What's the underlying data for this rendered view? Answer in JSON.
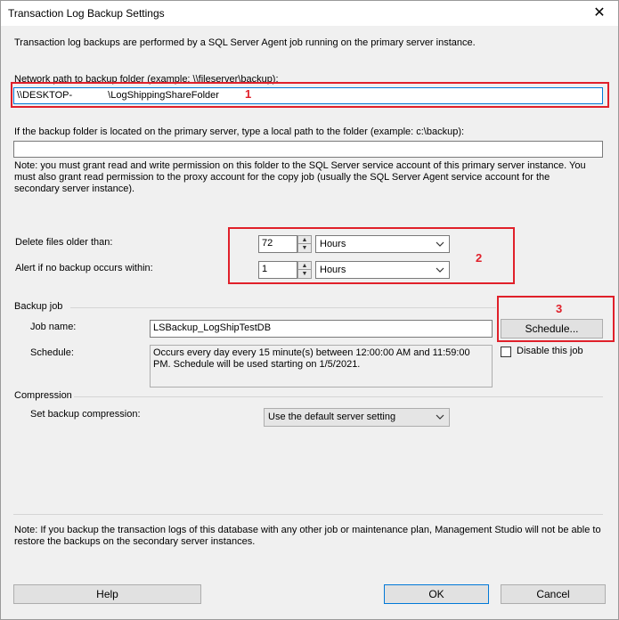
{
  "window": {
    "title": "Transaction Log Backup Settings",
    "close": "✕"
  },
  "intro": "Transaction log backups are performed by a SQL Server Agent job running on the primary server instance.",
  "network_path": {
    "label": "Network path to backup folder (example: \\\\fileserver\\backup):",
    "value_prefix": "\\\\DESKTOP-",
    "value_suffix": "\\LogShippingShareFolder"
  },
  "local_path": {
    "label": "If the backup folder is located on the primary server, type a local path to the folder (example: c:\\backup):",
    "value": ""
  },
  "permission_note": "Note: you must grant read and write permission on this folder to the SQL Server service account of this primary server instance.  You must also grant read permission to the proxy account for the copy job (usually the SQL Server Agent service account for the secondary server instance).",
  "delete_files": {
    "label": "Delete files older than:",
    "value": "72",
    "unit": "Hours"
  },
  "alert": {
    "label": "Alert if no backup occurs within:",
    "value": "1",
    "unit": "Hours"
  },
  "backup_job": {
    "group_label": "Backup job",
    "job_name_label": "Job name:",
    "job_name": "LSBackup_LogShipTestDB",
    "schedule_label": "Schedule:",
    "schedule_text": "Occurs every day every 15 minute(s) between 12:00:00 AM and 11:59:00 PM. Schedule will be used starting on 1/5/2021.",
    "schedule_button": "Schedule...",
    "disable_label": "Disable this job"
  },
  "compression": {
    "group_label": "Compression",
    "label": "Set backup compression:",
    "value": "Use the default server setting"
  },
  "footer_note": "Note: If you backup the transaction logs of this database with any other job or maintenance plan, Management Studio will not be able to restore the backups on the secondary server instances.",
  "buttons": {
    "help": "Help",
    "ok": "OK",
    "cancel": "Cancel"
  },
  "annotations": {
    "one": "1",
    "two": "2",
    "three": "3"
  },
  "colors": {
    "annotation": "#e0202a",
    "focus": "#0078d7"
  }
}
